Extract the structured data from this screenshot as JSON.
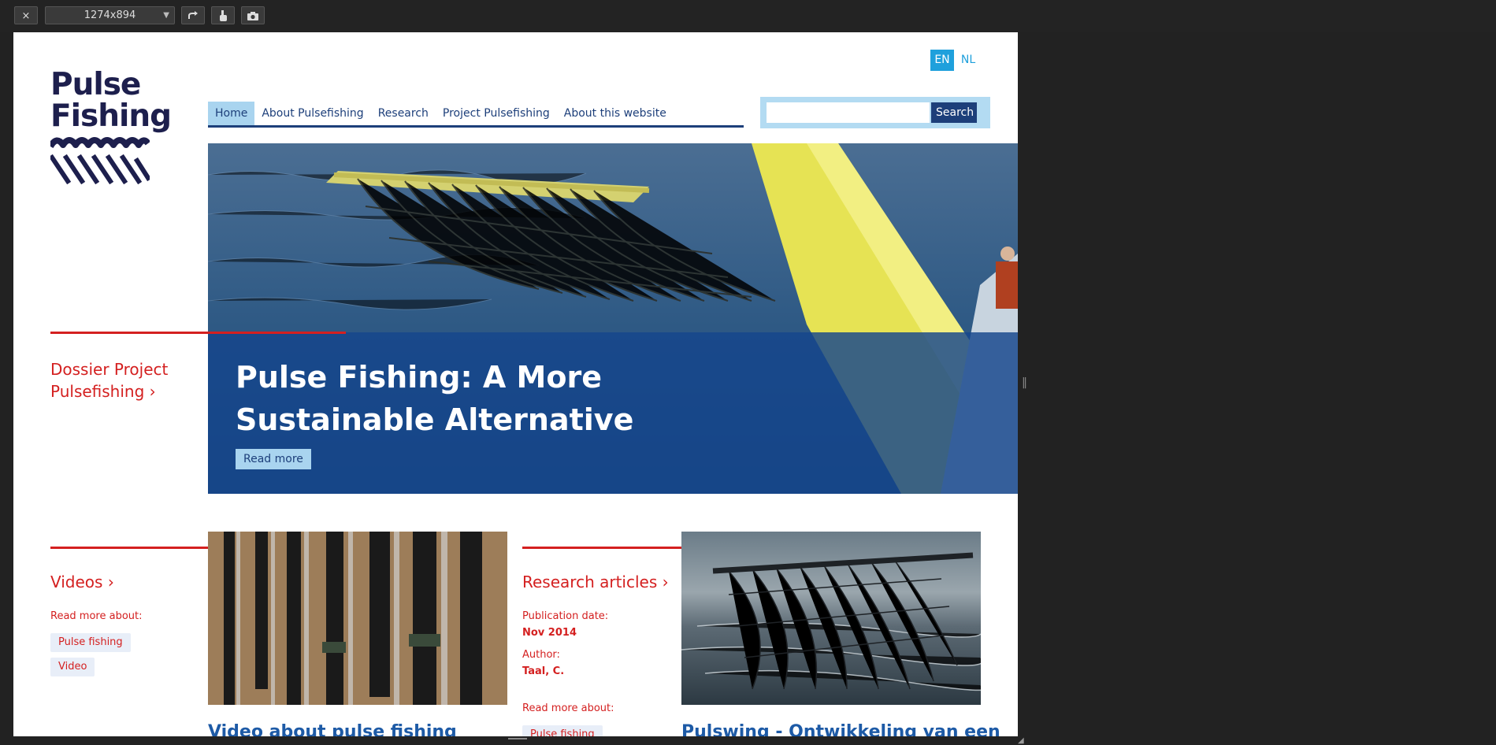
{
  "toolbar": {
    "close_icon": "×",
    "size_label": "1274x894",
    "rotate_icon": "rotate-icon",
    "touch_icon": "touch-icon",
    "camera_icon": "camera-icon"
  },
  "logo": {
    "line1": "Pulse",
    "line2": "Fishing"
  },
  "lang": {
    "en": "EN",
    "nl": "NL"
  },
  "nav": {
    "items": [
      {
        "label": "Home"
      },
      {
        "label": "About Pulsefishing"
      },
      {
        "label": "Research"
      },
      {
        "label": "Project Pulsefishing"
      },
      {
        "label": "About this website"
      }
    ]
  },
  "search": {
    "button": "Search",
    "value": ""
  },
  "hero": {
    "title": "Pulse Fishing: A More Sustainable Alternative",
    "button": "Read more"
  },
  "dossier": {
    "label": "Dossier Project Pulsefishing ›"
  },
  "videos": {
    "title": "Videos ›",
    "read_more_about": "Read more about:",
    "tags": [
      "Pulse fishing",
      "Video"
    ],
    "card_title": "Video about pulse fishing"
  },
  "research": {
    "title": "Research articles ›",
    "publication_label": "Publication date:",
    "publication_value": "Nov 2014",
    "author_label": "Author:",
    "author_value": "Taal, C.",
    "read_more_about": "Read more about:",
    "tag": "Pulse fishing",
    "card_title": "Pulswing - Ontwikkeling van een"
  },
  "colors": {
    "accent_red": "#d42020",
    "navy": "#1d3f7a",
    "light_blue": "#a9d4ef",
    "lang_blue": "#1fa0dc"
  }
}
